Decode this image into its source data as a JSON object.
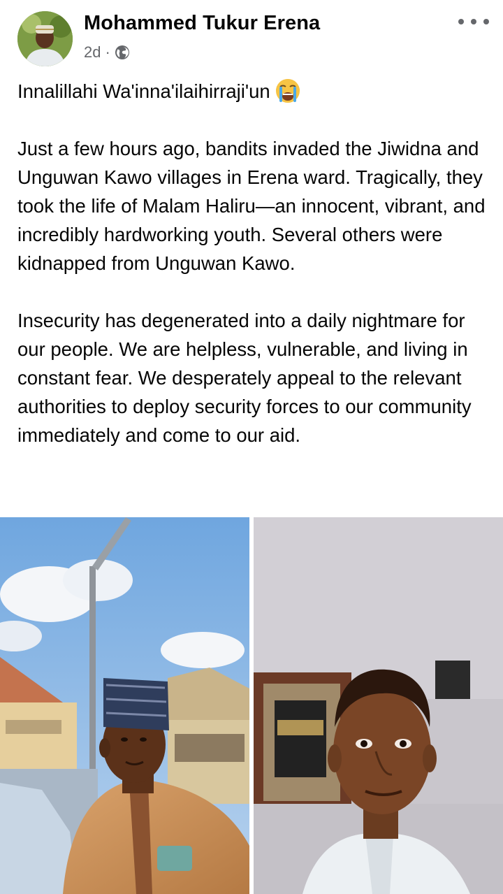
{
  "post": {
    "author": "Mohammed Tukur Erena",
    "time": "2d",
    "separator": "·",
    "privacy_icon": "globe-icon",
    "more_icon": "more-options-icon",
    "paragraphs": [
      "Innalillahi Wa'inna'ilaihirraji'un",
      "Just a few hours ago, bandits invaded the Jiwidna and Unguwan Kawo villages in Erena ward. Tragically, they took the life of Malam Haliru—an innocent, vibrant, and incredibly hardworking youth. Several others were kidnapped from Unguwan Kawo.",
      "Insecurity has degenerated into a daily nightmare for our people. We are helpless, vulnerable, and living in constant fear. We desperately appeal to the relevant authorities to deploy security forces to our community immediately and come to our aid."
    ],
    "emoji_icon": "loudly-crying-face-icon",
    "photos": [
      {
        "icon": "photo-young-man-outdoors"
      },
      {
        "icon": "photo-young-man-indoors"
      }
    ]
  },
  "colors": {
    "text": "#050505",
    "secondary_text": "#65676b",
    "background": "#ffffff"
  }
}
